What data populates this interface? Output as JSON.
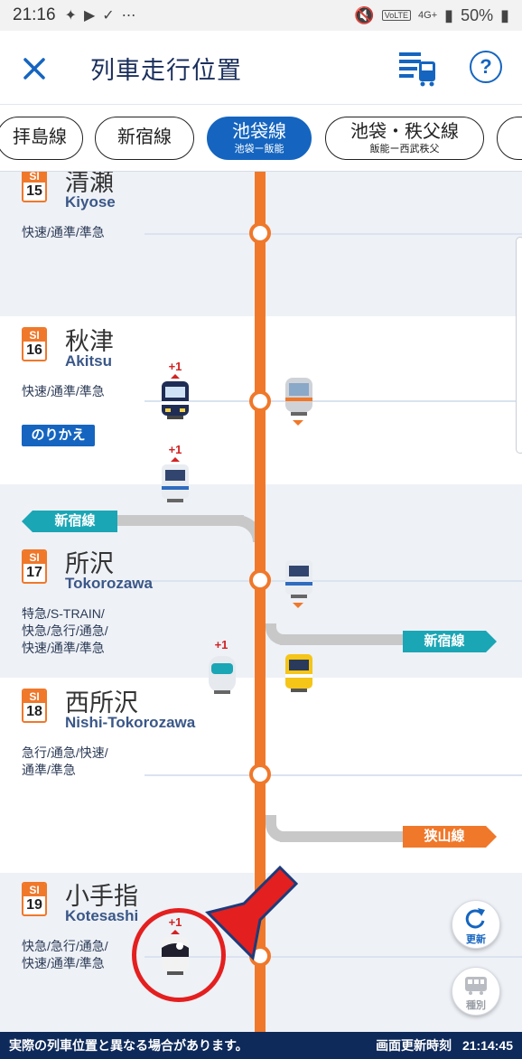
{
  "status_bar": {
    "time": "21:16",
    "network": "4G+",
    "battery": "50%",
    "volte": "VoLTE"
  },
  "header": {
    "title": "列車走行位置"
  },
  "tabs": [
    {
      "label": "拝島線",
      "sub": ""
    },
    {
      "label": "新宿線",
      "sub": ""
    },
    {
      "label": "池袋線",
      "sub": "池袋ー飯能",
      "active": true
    },
    {
      "label": "池袋・秩父線",
      "sub": "飯能ー西武秩父"
    }
  ],
  "stations": [
    {
      "code": "SI",
      "num": "15",
      "name": "清瀬",
      "roma": "Kiyose",
      "types": [
        "快速/通準/準急"
      ]
    },
    {
      "code": "SI",
      "num": "16",
      "name": "秋津",
      "roma": "Akitsu",
      "types": [
        "快速/通準/準急"
      ],
      "transfer": "のりかえ"
    },
    {
      "code": "SI",
      "num": "17",
      "name": "所沢",
      "roma": "Tokorozawa",
      "types": [
        "特急/S-TRAIN/",
        "快急/急行/通急/",
        "快速/通準/準急"
      ]
    },
    {
      "code": "SI",
      "num": "18",
      "name": "西所沢",
      "roma": "Nishi-Tokorozawa",
      "types": [
        "急行/通急/快速/",
        "通準/準急"
      ]
    },
    {
      "code": "SI",
      "num": "19",
      "name": "小手指",
      "roma": "Kotesashi",
      "types": [
        "快急/急行/通急/",
        "快速/通準/準急"
      ]
    }
  ],
  "branches": {
    "shinjuku_left": "新宿線",
    "shinjuku_right": "新宿線",
    "sayama": "狭山線"
  },
  "train_delays": [
    "+1",
    "+1",
    "+1",
    "+1"
  ],
  "buttons": {
    "refresh": "更新",
    "type": "種別"
  },
  "footer": {
    "notice": "実際の列車位置と異なる場合があります。",
    "update_label": "画面更新時刻",
    "update_time": "21:14:45"
  },
  "colors": {
    "line": "#f0782a",
    "accent": "#1565c0",
    "branch": "#1aa6b5",
    "footer": "#0e2a5a"
  }
}
